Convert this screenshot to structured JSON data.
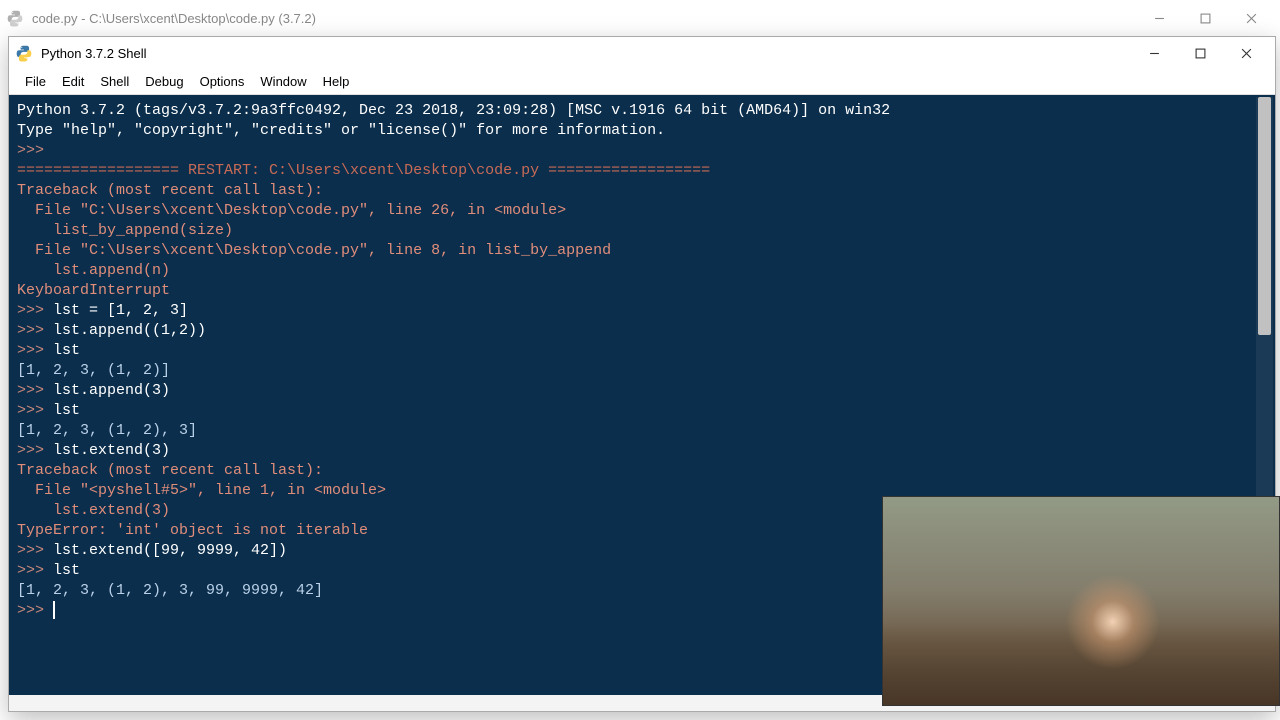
{
  "back_window": {
    "title": "code.py - C:\\Users\\xcent\\Desktop\\code.py (3.7.2)"
  },
  "front_window": {
    "title": "Python 3.7.2 Shell"
  },
  "menu": {
    "items": [
      "File",
      "Edit",
      "Shell",
      "Debug",
      "Options",
      "Window",
      "Help"
    ]
  },
  "shell": {
    "banner1": "Python 3.7.2 (tags/v3.7.2:9a3ffc0492, Dec 23 2018, 23:09:28) [MSC v.1916 64 bit (AMD64)] on win32",
    "banner2": "Type \"help\", \"copyright\", \"credits\" or \"license()\" for more information.",
    "prompt": ">>> ",
    "restart": "================== RESTART: C:\\Users\\xcent\\Desktop\\code.py ==================",
    "tb1_a": "Traceback (most recent call last):",
    "tb1_b": "  File \"C:\\Users\\xcent\\Desktop\\code.py\", line 26, in <module>",
    "tb1_c": "    list_by_append(size)",
    "tb1_d": "  File \"C:\\Users\\xcent\\Desktop\\code.py\", line 8, in list_by_append",
    "tb1_e": "    lst.append(n)",
    "tb1_f": "KeyboardInterrupt",
    "in1": "lst = [1, 2, 3]",
    "in2": "lst.append((1,2))",
    "in3": "lst",
    "out3": "[1, 2, 3, (1, 2)]",
    "in4": "lst.append(3)",
    "in5": "lst",
    "out5": "[1, 2, 3, (1, 2), 3]",
    "in6": "lst.extend(3)",
    "tb2_a": "Traceback (most recent call last):",
    "tb2_b": "  File \"<pyshell#5>\", line 1, in <module>",
    "tb2_c": "    lst.extend(3)",
    "tb2_d": "TypeError: 'int' object is not iterable",
    "in7": "lst.extend([99, 9999, 42])",
    "in8": "lst",
    "out8": "[1, 2, 3, (1, 2), 3, 99, 9999, 42]"
  }
}
